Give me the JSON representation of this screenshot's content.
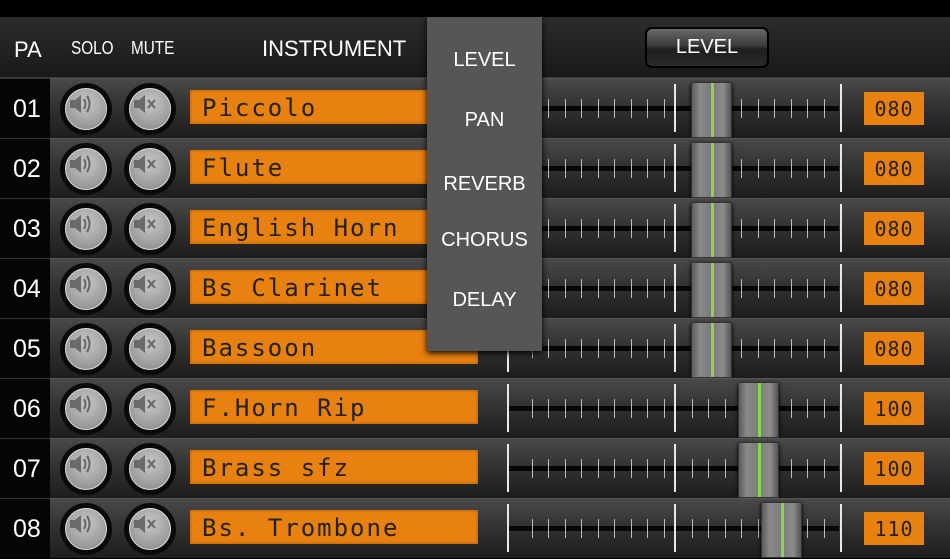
{
  "header": {
    "pa": "PA",
    "solo": "SOLO",
    "mute": "MUTE",
    "instrument": "INSTRUMENT",
    "parameter_button": "LEVEL"
  },
  "fader_range": [
    0,
    127
  ],
  "rows": [
    {
      "part": "01",
      "instrument": "Piccolo",
      "value": "080",
      "level": 80
    },
    {
      "part": "02",
      "instrument": "Flute",
      "value": "080",
      "level": 80
    },
    {
      "part": "03",
      "instrument": "English Horn",
      "value": "080",
      "level": 80
    },
    {
      "part": "04",
      "instrument": "Bs Clarinet",
      "value": "080",
      "level": 80
    },
    {
      "part": "05",
      "instrument": "Bassoon",
      "value": "080",
      "level": 80
    },
    {
      "part": "06",
      "instrument": "F.Horn Rip",
      "value": "100",
      "level": 100
    },
    {
      "part": "07",
      "instrument": "Brass sfz",
      "value": "100",
      "level": 100
    },
    {
      "part": "08",
      "instrument": "Bs. Trombone",
      "value": "110",
      "level": 110
    }
  ],
  "icons": {
    "solo": "speaker-icon",
    "mute": "speaker-mute-icon"
  },
  "dropdown_menu": {
    "items": [
      "LEVEL",
      "PAN",
      "REVERB",
      "CHORUS",
      "DELAY"
    ]
  },
  "colors": {
    "lcd_orange": "#e8810f",
    "fader_line": "#8ad84a"
  }
}
